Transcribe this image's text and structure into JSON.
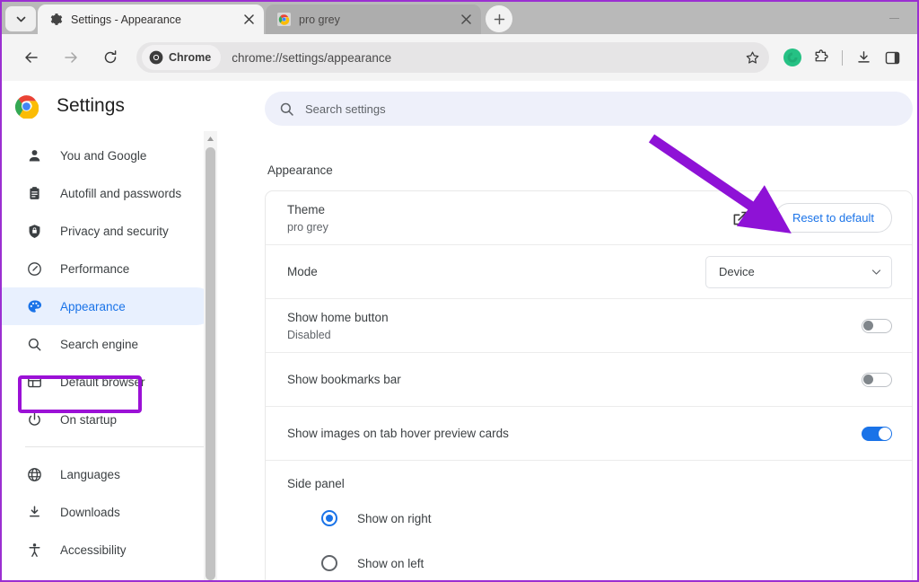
{
  "window": {
    "minimize_label": "Minimize"
  },
  "tabstrip": {
    "tab_search_icon": "chevron-down-icon",
    "new_tab_label": "+",
    "tabs": [
      {
        "title": "Settings - Appearance",
        "favicon": "gear-icon",
        "active": true,
        "close_label": "×"
      },
      {
        "title": "pro grey",
        "favicon": "chrome-icon",
        "active": false,
        "close_label": "×"
      }
    ]
  },
  "toolbar": {
    "back_icon": "arrow-left-icon",
    "forward_icon": "arrow-right-icon",
    "reload_icon": "reload-icon",
    "chrome_chip_label": "Chrome",
    "chrome_chip_icon": "chrome-icon",
    "url": "chrome://settings/appearance",
    "bookmark_icon": "star-icon",
    "profile_icon": "profile-avatar-icon",
    "extensions_icon": "puzzle-piece-icon",
    "downloads_icon": "download-icon",
    "side_panel_icon": "side-panel-icon"
  },
  "sidebar": {
    "brand_title": "Settings",
    "brand_icon": "chrome-logo-icon",
    "items": [
      {
        "label": "You and Google",
        "icon": "person-icon"
      },
      {
        "label": "Autofill and passwords",
        "icon": "clipboard-icon"
      },
      {
        "label": "Privacy and security",
        "icon": "shield-icon"
      },
      {
        "label": "Performance",
        "icon": "speedometer-icon"
      },
      {
        "label": "Appearance",
        "icon": "palette-icon",
        "active": true
      },
      {
        "label": "Search engine",
        "icon": "search-icon"
      },
      {
        "label": "Default browser",
        "icon": "browser-window-icon"
      },
      {
        "label": "On startup",
        "icon": "power-icon"
      }
    ],
    "items2": [
      {
        "label": "Languages",
        "icon": "globe-icon"
      },
      {
        "label": "Downloads",
        "icon": "download-icon"
      },
      {
        "label": "Accessibility",
        "icon": "accessibility-icon"
      }
    ],
    "scrollbar_up_icon": "triangle-up-icon"
  },
  "main": {
    "search": {
      "placeholder": "Search settings",
      "icon": "search-icon"
    },
    "section_title": "Appearance",
    "rows": {
      "theme": {
        "title": "Theme",
        "subtitle": "pro grey",
        "external_link_icon": "external-link-icon",
        "reset_label": "Reset to default"
      },
      "mode": {
        "title": "Mode",
        "value": "Device",
        "dropdown_icon": "chevron-down-icon"
      },
      "home_button": {
        "title": "Show home button",
        "subtitle": "Disabled",
        "toggle": "off"
      },
      "bookmarks_bar": {
        "title": "Show bookmarks bar",
        "toggle": "off"
      },
      "tab_hover": {
        "title": "Show images on tab hover preview cards",
        "toggle": "on"
      },
      "side_panel": {
        "title": "Side panel",
        "options": [
          {
            "label": "Show on right",
            "selected": true
          },
          {
            "label": "Show on left",
            "selected": false
          }
        ]
      }
    }
  },
  "annotations": {
    "arrow_color": "#8e12d6",
    "highlight_color": "#9b11d6",
    "arrow_target": "Reset to default",
    "highlight_target": "Appearance"
  },
  "colors": {
    "accent_blue": "#1a73e8",
    "active_nav_bg": "#e8f0fe",
    "toolbar_bg": "#f4f4f4",
    "tabstrip_bg": "#b9b9b9",
    "search_bg": "#eef0fa"
  }
}
